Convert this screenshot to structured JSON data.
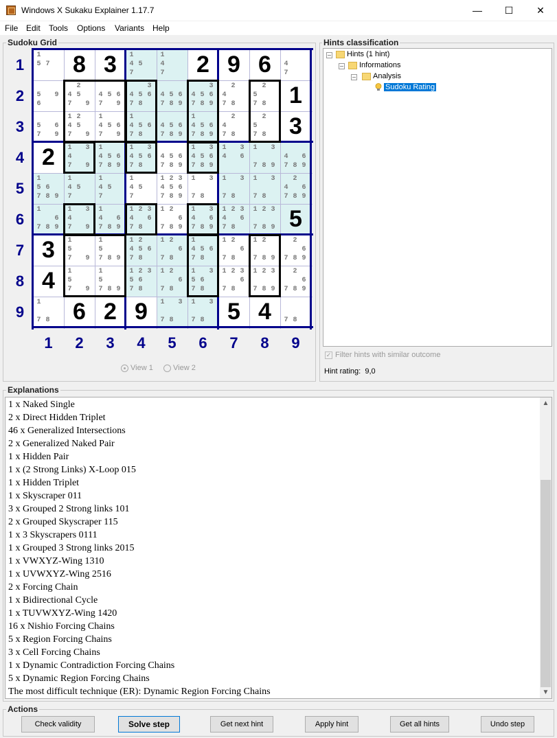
{
  "window": {
    "title": "Windows X Sukaku Explainer 1.17.7"
  },
  "menu": [
    "File",
    "Edit",
    "Tools",
    "Options",
    "Variants",
    "Help"
  ],
  "grid_panel": {
    "title": "Sudoku Grid"
  },
  "grid": {
    "row_labels": [
      "1",
      "2",
      "3",
      "4",
      "5",
      "6",
      "7",
      "8",
      "9"
    ],
    "col_labels": [
      "1",
      "2",
      "3",
      "4",
      "5",
      "6",
      "7",
      "8",
      "9"
    ],
    "cells": [
      [
        {
          "c": "1|57"
        },
        {
          "v": "8"
        },
        {
          "v": "3"
        },
        {
          "c": "1|45|7"
        },
        {
          "c": "1|4|7"
        },
        {
          "v": "2"
        },
        {
          "v": "9"
        },
        {
          "v": "6"
        },
        {
          "c": "|4|7"
        }
      ],
      [
        {
          "c": "|5 9|6"
        },
        {
          "c": " 2|45|7 9"
        },
        {
          "c": "|456|7 9"
        },
        {
          "c": "  3|456|78"
        },
        {
          "c": "|456|789"
        },
        {
          "c": "  3|456|789"
        },
        {
          "c": " 2|4|78"
        },
        {
          "c": " 2|5|78"
        },
        {
          "v": "1"
        }
      ],
      [
        {
          "c": "|5 6|7 9"
        },
        {
          "c": "12|45|7 9"
        },
        {
          "c": "1|456|7 9"
        },
        {
          "c": "1|456|78"
        },
        {
          "c": "|456|789"
        },
        {
          "c": "1|456|789"
        },
        {
          "c": " 2|4|78"
        },
        {
          "c": " 2|5|78"
        },
        {
          "v": "3"
        }
      ],
      [
        {
          "v": "2"
        },
        {
          "c": "1 3|4|7 9"
        },
        {
          "c": "1|456|789"
        },
        {
          "c": "1 3|456|78"
        },
        {
          "c": "|456|789"
        },
        {
          "c": "1 3|456|789"
        },
        {
          "c": "1 3|4 6|"
        },
        {
          "c": "1 3||789"
        },
        {
          "c": "|4 6|789"
        }
      ],
      [
        {
          "c": "1|56|789"
        },
        {
          "c": "1|45|7"
        },
        {
          "c": "1|45|7"
        },
        {
          "c": "1|45|7"
        },
        {
          "c": "123|456|789"
        },
        {
          "c": "1 3||78"
        },
        {
          "c": "1 3||78"
        },
        {
          "c": "1 3||78"
        },
        {
          "c": " 2|4 6|789"
        }
      ],
      [
        {
          "c": "1|  6|789"
        },
        {
          "c": "1 3|4|7 9"
        },
        {
          "c": "1|4 6|789"
        },
        {
          "c": "123|4 6|78"
        },
        {
          "c": "12|  6|789"
        },
        {
          "c": "1 3|4 6|789"
        },
        {
          "c": "123|4 6|78"
        },
        {
          "c": "123||789"
        },
        {
          "v": "5"
        }
      ],
      [
        {
          "v": "3"
        },
        {
          "c": "1|5|7 9"
        },
        {
          "c": "1|5|789"
        },
        {
          "c": "12|456|78"
        },
        {
          "c": "12|  6|78"
        },
        {
          "c": "1|456|78"
        },
        {
          "c": "12|  6|78"
        },
        {
          "c": "12||789"
        },
        {
          "c": " 2|  6|789"
        }
      ],
      [
        {
          "v": "4"
        },
        {
          "c": "1|5|7 9"
        },
        {
          "c": "1|5|789"
        },
        {
          "c": "123|56|78"
        },
        {
          "c": "12|  6|78"
        },
        {
          "c": "1 3|56|78"
        },
        {
          "c": "123|  6|78"
        },
        {
          "c": "123||789"
        },
        {
          "c": " 2|  6|789"
        }
      ],
      [
        {
          "c": "1||78"
        },
        {
          "v": "6"
        },
        {
          "v": "2"
        },
        {
          "v": "9"
        },
        {
          "c": "1 3||78"
        },
        {
          "c": "1 3||78"
        },
        {
          "v": "5"
        },
        {
          "v": "4"
        },
        {
          "c": "||78"
        }
      ]
    ]
  },
  "views": {
    "view1": "View 1",
    "view2": "View 2"
  },
  "hints_panel": {
    "title": "Hints classification",
    "tree": [
      "Hints (1 hint)",
      "Informations",
      "Analysis",
      "Sudoku Rating"
    ],
    "filter_label": "Filter hints with similar outcome",
    "rating_label": "Hint rating:",
    "rating_value": "9,0"
  },
  "explanations": {
    "title": "Explanations",
    "lines": [
      "1 x Naked Single",
      "2 x Direct Hidden Triplet",
      "46 x Generalized Intersections",
      "2 x Generalized Naked Pair",
      "1 x Hidden Pair",
      "1 x (2 Strong Links) X-Loop 015",
      "1 x Hidden Triplet",
      "1 x Skyscraper 011",
      "3 x Grouped 2 Strong links 101",
      "2 x Grouped Skyscraper 115",
      "1 x 3 Skyscrapers 0111",
      "1 x Grouped 3 Strong links 2015",
      "1 x VWXYZ-Wing 1310",
      "1 x UVWXYZ-Wing 2516",
      "2 x Forcing Chain",
      "1 x Bidirectional Cycle",
      "1 x TUVWXYZ-Wing 1420",
      "16 x Nishio Forcing Chains",
      "5 x Region Forcing Chains",
      "3 x Cell Forcing Chains",
      "1 x Dynamic Contradiction Forcing Chains",
      "5 x Dynamic Region Forcing Chains",
      "The most difficult technique (ER): Dynamic Region Forcing Chains"
    ]
  },
  "actions": {
    "title": "Actions",
    "buttons": [
      "Check validity",
      "Solve step",
      "Get next hint",
      "Apply hint",
      "Get all hints",
      "Undo step"
    ]
  },
  "colors": {
    "box_border": "#00008b",
    "cell_highlight": "#dcf2f2",
    "selection": "#0078d7"
  },
  "icons": [
    "app-icon",
    "minimize-icon",
    "maximize-icon",
    "close-icon",
    "folder-icon",
    "lightbulb-icon",
    "scroll-up-icon",
    "scroll-down-icon"
  ]
}
